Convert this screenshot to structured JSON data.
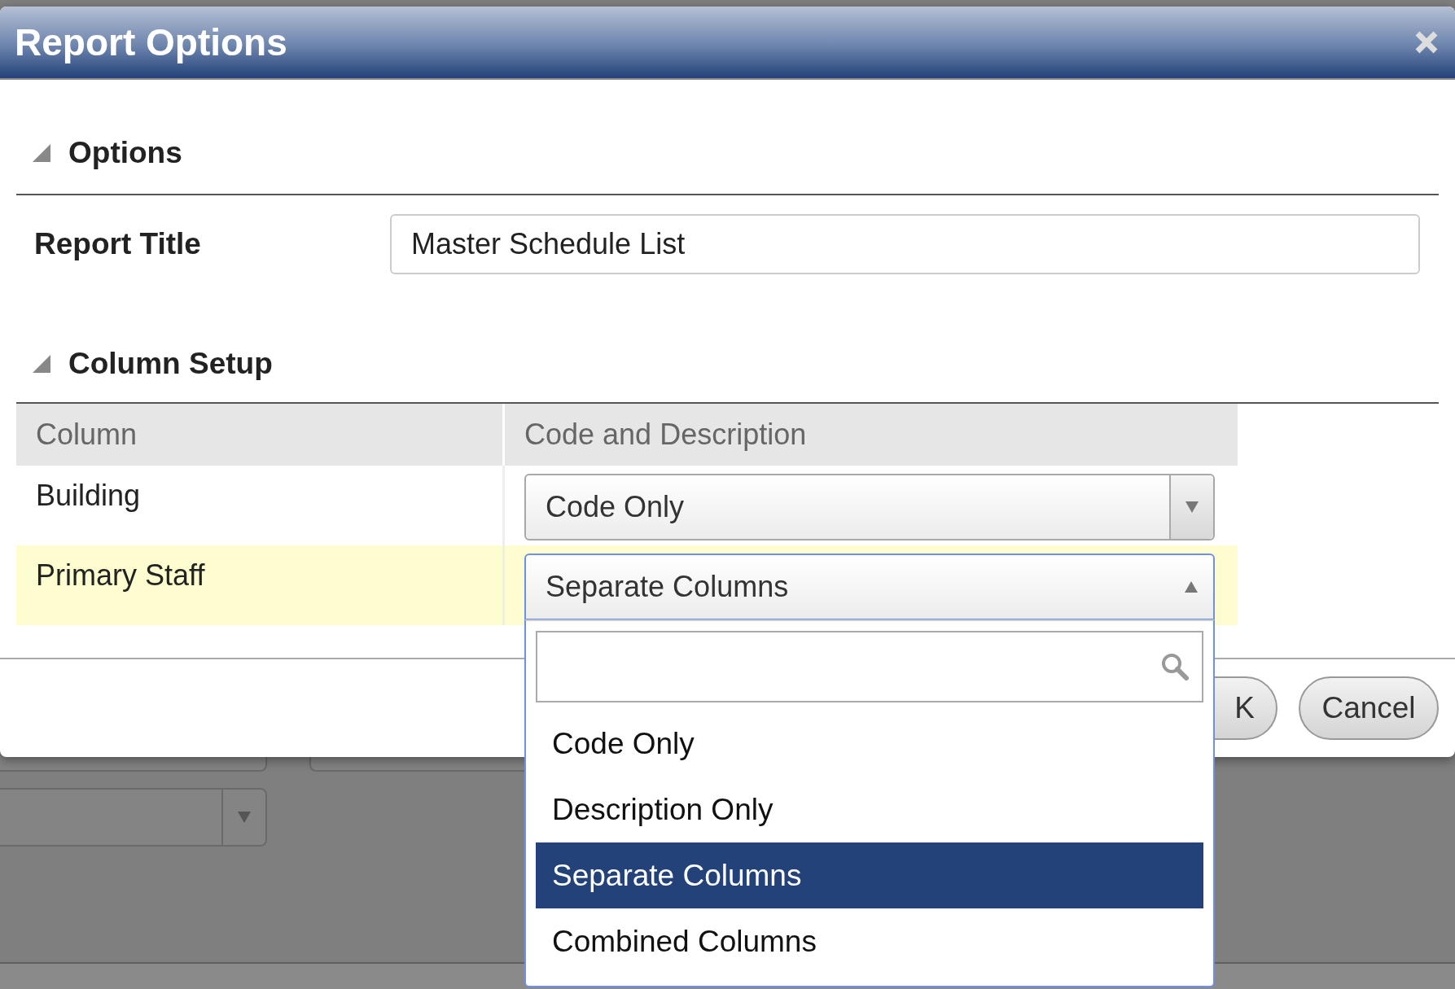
{
  "window": {
    "title": "Report Options"
  },
  "options": {
    "title": "Options",
    "expanded": true,
    "fields": [
      {
        "label": "Report Title",
        "value": "Master Schedule List"
      }
    ]
  },
  "column_setup": {
    "title": "Column Setup",
    "expanded": true,
    "columns": [
      "Column",
      "Code and Description"
    ],
    "rows": [
      {
        "column": "Building",
        "value": "Code Only",
        "open": false,
        "highlighted": false
      },
      {
        "column": "Primary Staff",
        "value": "Separate Columns",
        "open": true,
        "highlighted": true
      }
    ]
  },
  "dropdown": {
    "options": [
      {
        "label": "Code Only",
        "selected": false
      },
      {
        "label": "Description Only",
        "selected": false
      },
      {
        "label": "Separate Columns",
        "selected": true
      },
      {
        "label": "Combined Columns",
        "selected": false
      }
    ]
  },
  "buttons": [
    {
      "label": "K"
    },
    {
      "label": "Cancel"
    }
  ]
}
